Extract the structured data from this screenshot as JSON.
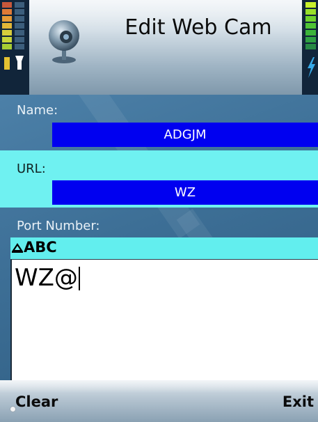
{
  "header": {
    "title": "Edit Web Cam",
    "icon": "webcam-icon"
  },
  "status": {
    "signal_icon": "signal-strength-icon",
    "battery_icon": "battery-level-icon"
  },
  "form": {
    "name": {
      "label": "Name:",
      "value": "ADGJM"
    },
    "url": {
      "label": "URL:",
      "value": "WZ"
    },
    "port": {
      "label": "Port Number:",
      "input_mode": "ABC",
      "input_mode_icon": "pen-input-icon",
      "value": "WZ@"
    }
  },
  "softkeys": {
    "left": "Clear",
    "right": "Exit"
  },
  "colors": {
    "field_highlight": "#0000f0",
    "selected_row": "#6ff1f1",
    "background": "#3f6f93"
  }
}
